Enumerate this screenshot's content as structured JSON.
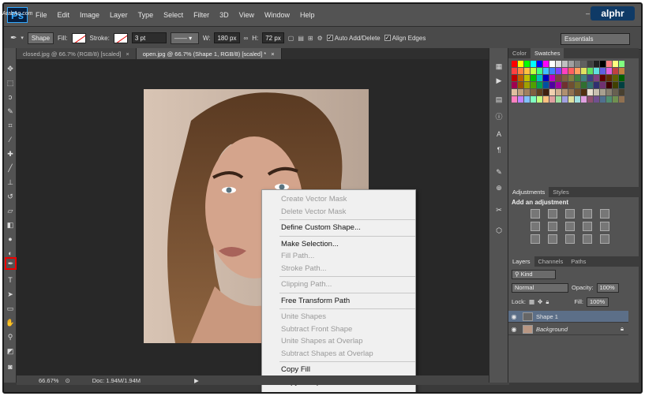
{
  "watermark": "ArabAq.com",
  "brand_badge": "alphr",
  "menubar": {
    "logo": "Ps",
    "items": [
      "File",
      "Edit",
      "Image",
      "Layer",
      "Type",
      "Select",
      "Filter",
      "3D",
      "View",
      "Window",
      "Help"
    ],
    "window_controls": [
      "–",
      "□",
      "✕"
    ]
  },
  "options": {
    "mode": "Shape",
    "fill_label": "Fill:",
    "stroke_label": "Stroke:",
    "stroke_width": "3 pt",
    "w_label": "W:",
    "w_value": "180 px",
    "h_label": "H:",
    "h_value": "72 px",
    "auto_add_delete": "Auto Add/Delete",
    "align_edges": "Align Edges",
    "workspace": "Essentials"
  },
  "tabs": [
    {
      "label": "closed.jpg @ 66.7% (RGB/8) [scaled]",
      "active": false
    },
    {
      "label": "open.jpg @ 66.7% (Shape 1, RGB/8) [scaled] *",
      "active": true
    }
  ],
  "status": {
    "zoom": "66.67%",
    "doc": "Doc: 1.94M/1.94M"
  },
  "context_menu": [
    {
      "label": "Create Vector Mask",
      "disabled": true
    },
    {
      "label": "Delete Vector Mask",
      "disabled": true
    },
    {
      "sep": true
    },
    {
      "label": "Define Custom Shape...",
      "disabled": false
    },
    {
      "sep": true
    },
    {
      "label": "Make Selection...",
      "disabled": false
    },
    {
      "label": "Fill Path...",
      "disabled": true
    },
    {
      "label": "Stroke Path...",
      "disabled": true
    },
    {
      "sep": true
    },
    {
      "label": "Clipping Path...",
      "disabled": true
    },
    {
      "sep": true
    },
    {
      "label": "Free Transform Path",
      "disabled": false
    },
    {
      "sep": true
    },
    {
      "label": "Unite Shapes",
      "disabled": true
    },
    {
      "label": "Subtract Front Shape",
      "disabled": true
    },
    {
      "label": "Unite Shapes at Overlap",
      "disabled": true
    },
    {
      "label": "Subtract Shapes at Overlap",
      "disabled": true
    },
    {
      "sep": true
    },
    {
      "label": "Copy Fill",
      "disabled": false
    },
    {
      "label": "Copy Complete Stroke",
      "disabled": false
    }
  ],
  "panels": {
    "color_tabs": [
      "Color",
      "Swatches"
    ],
    "adjust_tabs": [
      "Adjustments",
      "Styles"
    ],
    "adjust_heading": "Add an adjustment",
    "layers_tabs": [
      "Layers",
      "Channels",
      "Paths"
    ],
    "kind": "Kind",
    "blend": "Normal",
    "opacity_label": "Opacity:",
    "opacity": "100%",
    "lock_label": "Lock:",
    "fill_label": "Fill:",
    "fill": "100%",
    "layers": [
      {
        "name": "Shape 1",
        "selected": true
      },
      {
        "name": "Background",
        "selected": false
      }
    ]
  },
  "colors": {
    "accent_red": "#e00000",
    "selected_layer": "#5c6f88"
  }
}
